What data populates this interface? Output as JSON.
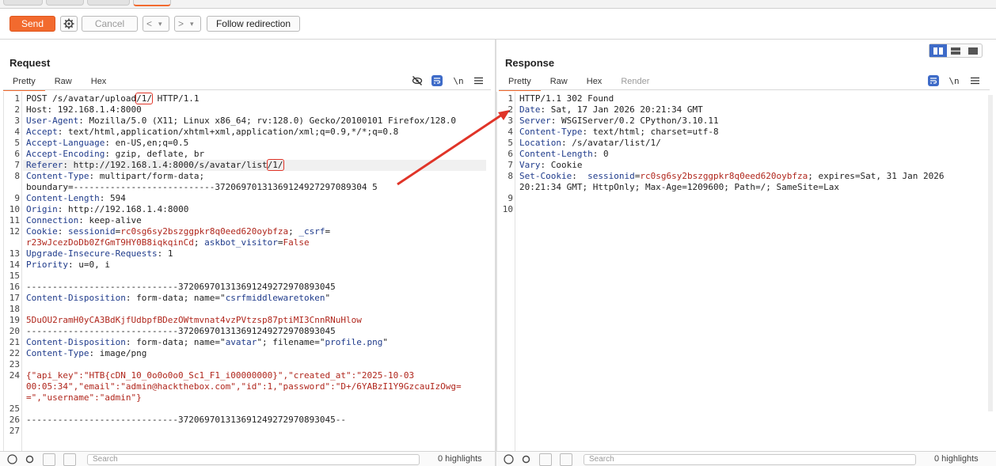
{
  "toolbar": {
    "send_label": "Send",
    "cancel_label": "Cancel",
    "back_label": "<",
    "forward_label": ">",
    "dropdown_glyph": "▾",
    "follow_label": "Follow redirection"
  },
  "request": {
    "title": "Request",
    "tabs": [
      "Pretty",
      "Raw",
      "Hex"
    ],
    "newline_label": "\\n",
    "search_placeholder": "Search",
    "highlights": "0 highlights",
    "lines": [
      {
        "n": "1",
        "parts": [
          [
            "POST /s/avatar/upload",
            ""
          ],
          [
            "/1/",
            "box"
          ],
          [
            " HTTP/1.1",
            ""
          ]
        ]
      },
      {
        "n": "2",
        "parts": [
          [
            "Host",
            ""
          ],
          [
            ": 192.168.1.4:8000",
            ""
          ]
        ]
      },
      {
        "n": "3",
        "parts": [
          [
            "User-Agent",
            "hk"
          ],
          [
            ": Mozilla/5.0 (X11; Linux x86_64; rv:128.0) Gecko/20100101 Firefox/128.0",
            ""
          ]
        ]
      },
      {
        "n": "4",
        "parts": [
          [
            "Accept",
            "hk"
          ],
          [
            ": text/html,application/xhtml+xml,application/xml;q=0.9,*/*;q=0.8",
            ""
          ]
        ]
      },
      {
        "n": "5",
        "parts": [
          [
            "Accept-Language",
            "hk"
          ],
          [
            ": en-US,en;q=0.5",
            ""
          ]
        ]
      },
      {
        "n": "6",
        "parts": [
          [
            "Accept-Encoding",
            "hk"
          ],
          [
            ": gzip, deflate, br",
            ""
          ]
        ]
      },
      {
        "n": "7",
        "parts": [
          [
            "Referer",
            "hk"
          ],
          [
            ": http://192.168.1.4:8000/s/avatar/list",
            ""
          ],
          [
            "/1/",
            "box"
          ]
        ],
        "hl": true
      },
      {
        "n": "8",
        "parts": [
          [
            "Content-Type",
            "hk"
          ],
          [
            ": multipart/form-data;",
            ""
          ]
        ]
      },
      {
        "n": "",
        "parts": [
          [
            "boundary=---------------------------37206970131369124927297089304 5",
            ""
          ]
        ]
      },
      {
        "n": "9",
        "parts": [
          [
            "Content-Length",
            "hk"
          ],
          [
            ": 594",
            ""
          ]
        ]
      },
      {
        "n": "10",
        "parts": [
          [
            "Origin",
            "hk"
          ],
          [
            ": http://192.168.1.4:8000",
            ""
          ]
        ]
      },
      {
        "n": "11",
        "parts": [
          [
            "Connection",
            "hk"
          ],
          [
            ": keep-alive",
            ""
          ]
        ]
      },
      {
        "n": "12",
        "parts": [
          [
            "Cookie",
            "hk"
          ],
          [
            ": ",
            ""
          ],
          [
            "sessionid",
            "blue"
          ],
          [
            "=",
            ""
          ],
          [
            "rc0sg6sy2bszggpkr8q0eed620oybfza",
            "red"
          ],
          [
            "; ",
            ""
          ],
          [
            "_csrf",
            "blue"
          ],
          [
            "=",
            ""
          ]
        ]
      },
      {
        "n": "",
        "parts": [
          [
            "r23wJcezDoDb0ZfGmT9HY0B8iqkqinCd",
            "red"
          ],
          [
            "; ",
            ""
          ],
          [
            "askbot_visitor",
            "blue"
          ],
          [
            "=",
            ""
          ],
          [
            "False",
            "red"
          ]
        ]
      },
      {
        "n": "13",
        "parts": [
          [
            "Upgrade-Insecure-Requests",
            "hk"
          ],
          [
            ": 1",
            ""
          ]
        ]
      },
      {
        "n": "14",
        "parts": [
          [
            "Priority",
            "hk"
          ],
          [
            ": u=0, i",
            ""
          ]
        ]
      },
      {
        "n": "15",
        "parts": [
          [
            "",
            ""
          ]
        ]
      },
      {
        "n": "16",
        "parts": [
          [
            "-----------------------------372069701313691249272970893045",
            ""
          ]
        ]
      },
      {
        "n": "17",
        "parts": [
          [
            "Content-Disposition",
            "hk"
          ],
          [
            ": form-data; name=\"",
            ""
          ],
          [
            "csrfmiddlewaretoken",
            "blue"
          ],
          [
            "\"",
            ""
          ]
        ]
      },
      {
        "n": "18",
        "parts": [
          [
            "",
            ""
          ]
        ]
      },
      {
        "n": "19",
        "parts": [
          [
            "5DuOU2ramH0yCA3BdKjfUdbpfBDezOWtmvnat4vzPVtzsp87ptiMI3CnnRNuHlow",
            "red"
          ]
        ]
      },
      {
        "n": "20",
        "parts": [
          [
            "-----------------------------372069701313691249272970893045",
            ""
          ]
        ]
      },
      {
        "n": "21",
        "parts": [
          [
            "Content-Disposition",
            "hk"
          ],
          [
            ": form-data; name=\"",
            ""
          ],
          [
            "avatar",
            "blue"
          ],
          [
            "\"; filename=\"",
            ""
          ],
          [
            "profile.png",
            "blue"
          ],
          [
            "\"",
            ""
          ]
        ]
      },
      {
        "n": "22",
        "parts": [
          [
            "Content-Type",
            "hk"
          ],
          [
            ": image/png",
            ""
          ]
        ]
      },
      {
        "n": "23",
        "parts": [
          [
            "",
            ""
          ]
        ]
      },
      {
        "n": "24",
        "parts": [
          [
            "{\"api_key\":\"HTB{cDN_10_0o0o0o0_Sc1_F1_i00000000}\",\"created_at\":\"2025-10-03",
            "red"
          ]
        ]
      },
      {
        "n": "",
        "parts": [
          [
            "00:05:34\",\"email\":\"admin@hackthebox.com\",\"id\":1,\"password\":\"D+/6YABzI1Y9GzcauIzOwg=",
            "red"
          ]
        ]
      },
      {
        "n": "",
        "parts": [
          [
            "=\",\"username\":\"admin\"}",
            "red"
          ]
        ]
      },
      {
        "n": "25",
        "parts": [
          [
            "",
            ""
          ]
        ]
      },
      {
        "n": "26",
        "parts": [
          [
            "-----------------------------372069701313691249272970893045--",
            ""
          ]
        ]
      },
      {
        "n": "27",
        "parts": [
          [
            "",
            ""
          ]
        ]
      }
    ]
  },
  "response": {
    "title": "Response",
    "tabs": [
      "Pretty",
      "Raw",
      "Hex",
      "Render"
    ],
    "newline_label": "\\n",
    "search_placeholder": "Search",
    "highlights": "0 highlights",
    "lines": [
      {
        "n": "1",
        "parts": [
          [
            "HTTP/1.1 302 Found",
            ""
          ]
        ]
      },
      {
        "n": "2",
        "parts": [
          [
            "Date",
            "hk"
          ],
          [
            ": Sat, 17 Jan 2026 20:21:34 GMT",
            ""
          ]
        ]
      },
      {
        "n": "3",
        "parts": [
          [
            "Server",
            "hk"
          ],
          [
            ": WSGIServer/0.2 CPython/3.10.11",
            ""
          ]
        ]
      },
      {
        "n": "4",
        "parts": [
          [
            "Content-Type",
            "hk"
          ],
          [
            ": text/html; charset=utf-8",
            ""
          ]
        ]
      },
      {
        "n": "5",
        "parts": [
          [
            "Location",
            "hk"
          ],
          [
            ": /s/avatar/list/1/",
            ""
          ]
        ]
      },
      {
        "n": "6",
        "parts": [
          [
            "Content-Length",
            "hk"
          ],
          [
            ": 0",
            ""
          ]
        ]
      },
      {
        "n": "7",
        "parts": [
          [
            "Vary",
            "hk"
          ],
          [
            ": Cookie",
            ""
          ]
        ]
      },
      {
        "n": "8",
        "parts": [
          [
            "Set-Cookie",
            "hk"
          ],
          [
            ":  ",
            ""
          ],
          [
            "sessionid",
            "blue"
          ],
          [
            "=",
            ""
          ],
          [
            "rc0sg6sy2bszggpkr8q0eed620oybfza",
            "red"
          ],
          [
            "; expires=Sat, 31 Jan 2026",
            ""
          ]
        ]
      },
      {
        "n": "",
        "parts": [
          [
            "20:21:34 GMT; HttpOnly; Max-Age=1209600; Path=/; SameSite=Lax",
            ""
          ]
        ]
      },
      {
        "n": "9",
        "parts": [
          [
            "",
            ""
          ]
        ]
      },
      {
        "n": "10",
        "parts": [
          [
            "",
            ""
          ]
        ]
      }
    ]
  },
  "colors": {
    "accent": "#f26a2e",
    "toggle_blue": "#3e6bc8",
    "annotation_red": "#e03428"
  },
  "icons": {
    "settings": "gear-icon",
    "hide": "eye-off-icon",
    "wrap": "wrap-icon",
    "menu": "hamburger-icon",
    "help": "help-icon",
    "prev": "chevron-left-icon",
    "next": "chevron-right-icon",
    "search": "search-icon"
  }
}
